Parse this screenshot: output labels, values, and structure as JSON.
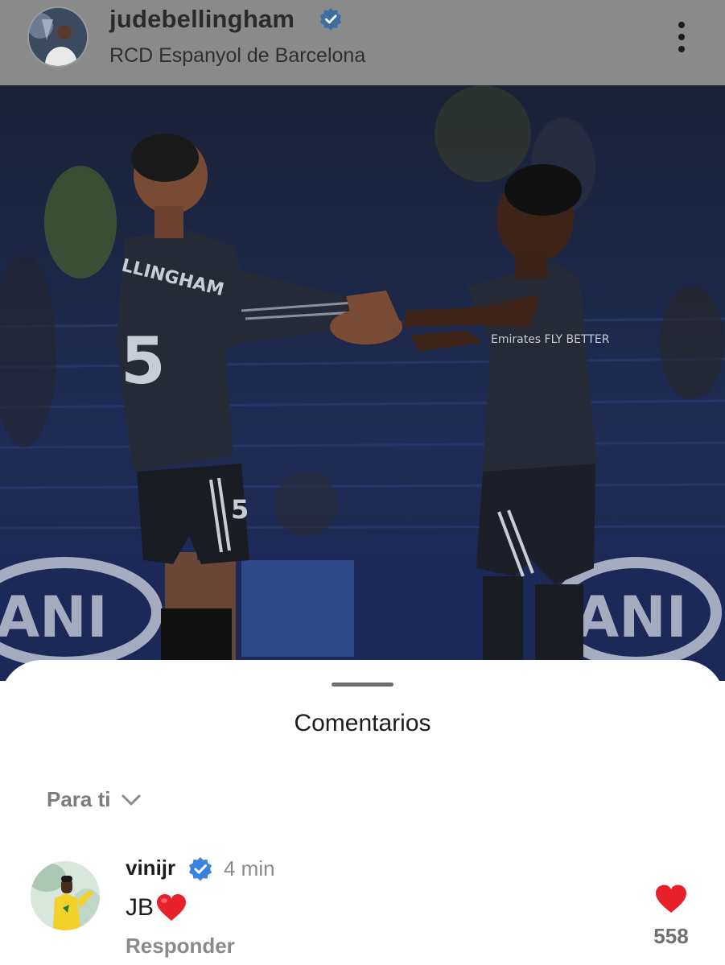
{
  "post": {
    "username": "judebellingham",
    "location": "RCD Espanyol de Barcelona",
    "verified": true,
    "icons": {
      "verified": "verified-badge-icon",
      "more": "more-options-icon"
    }
  },
  "photo": {
    "shirt_name": "LLINGHAM",
    "shirt_number_left": "5",
    "short_number_left": "5",
    "sponsor_text": "Emirates\nFLY BETTER",
    "board_text_left": "ANI",
    "board_text_right": "ANI"
  },
  "comments": {
    "title": "Comentarios",
    "filter_label": "Para ti",
    "items": [
      {
        "username": "vinijr",
        "verified": true,
        "time": "4 min",
        "text": "JB",
        "emoji": "heart-emoji",
        "reply_label": "Responder",
        "like_count": "558"
      }
    ]
  },
  "colors": {
    "header_bg": "#8a8a8a",
    "verified_blue": "#3d6fa3",
    "heart_red": "#e8202b"
  }
}
